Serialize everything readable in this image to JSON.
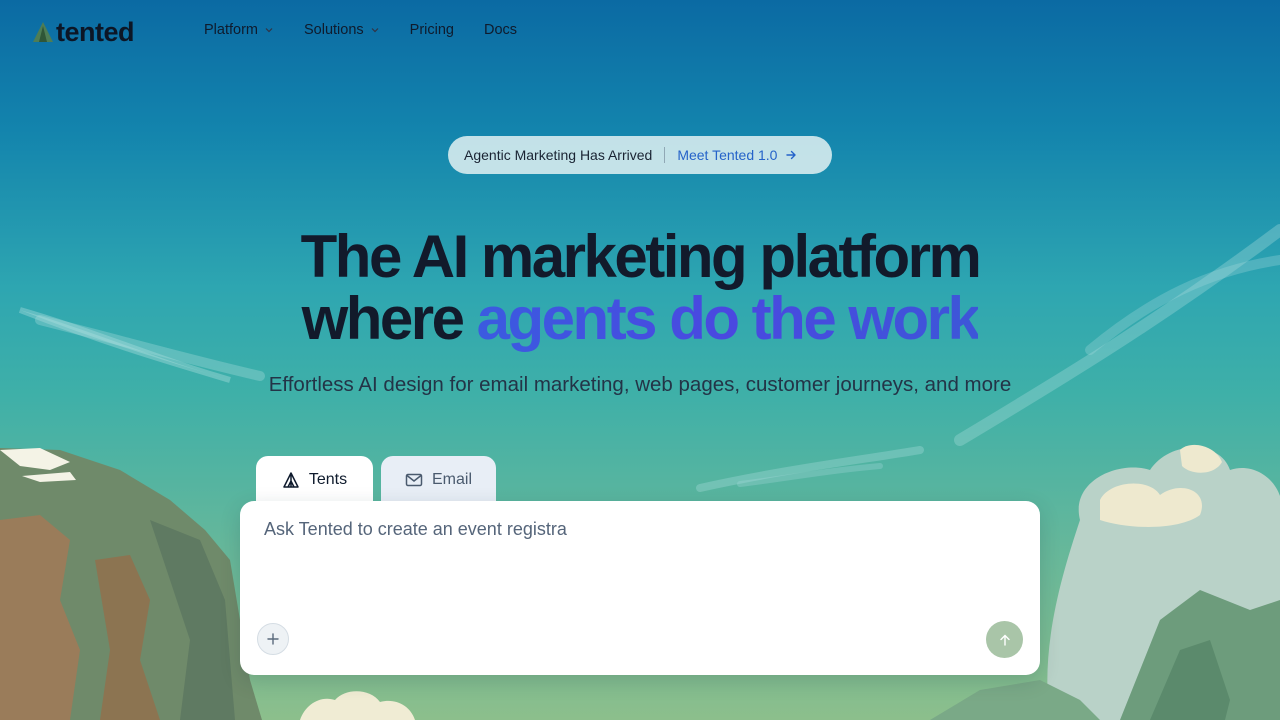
{
  "brand": {
    "name": "tented",
    "logo_icon": "tent-logo-icon"
  },
  "nav": {
    "items": [
      {
        "label": "Platform",
        "has_dropdown": true
      },
      {
        "label": "Solutions",
        "has_dropdown": true
      },
      {
        "label": "Pricing",
        "has_dropdown": false
      },
      {
        "label": "Docs",
        "has_dropdown": false
      }
    ]
  },
  "banner": {
    "text": "Agentic Marketing Has Arrived",
    "link_label": "Meet Tented 1.0",
    "link_icon": "arrow-right-icon"
  },
  "hero": {
    "title_line1": "The AI marketing platform",
    "title_line2_plain": "where ",
    "title_line2_accent": "agents do the work",
    "subtitle": "Effortless AI design for email marketing, web pages, customer journeys, and more"
  },
  "tabs": [
    {
      "label": "Tents",
      "icon": "tent-icon",
      "active": true
    },
    {
      "label": "Email",
      "icon": "mail-icon",
      "active": false
    }
  ],
  "prompt": {
    "value": "Ask Tented to create an event registra",
    "add_icon": "plus-icon",
    "send_icon": "arrow-up-icon"
  },
  "colors": {
    "accent": "#3b5be0",
    "sky_top": "#0b6aa3",
    "sky_mid": "#2ea6b1",
    "send_button": "#a9c5a8",
    "banner_link": "#2563c9"
  }
}
